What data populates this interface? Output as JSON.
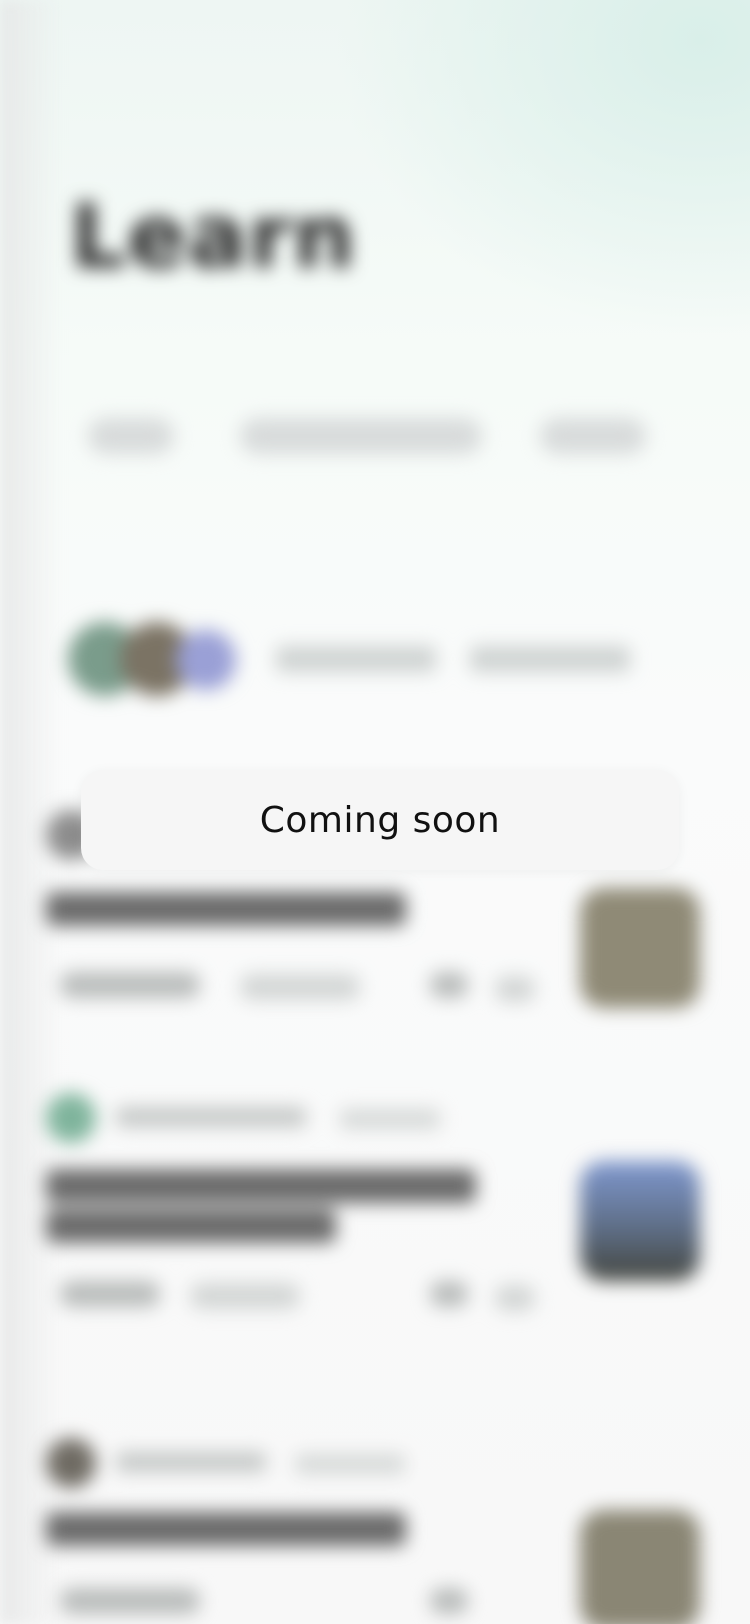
{
  "page": {
    "title": "Learn",
    "subtitle": "",
    "filters": [
      {
        "label": ""
      },
      {
        "label": ""
      },
      {
        "label": ""
      }
    ],
    "section_title": "",
    "articles": [
      {
        "author": "",
        "title": ""
      },
      {
        "author": "",
        "title": ""
      },
      {
        "author": "",
        "title": ""
      }
    ]
  },
  "toast": {
    "message": "Coming soon"
  },
  "colors": {
    "toast_bg": "#f6f6f6",
    "toast_text": "#111111",
    "background_tint": "#e3f3ee"
  }
}
